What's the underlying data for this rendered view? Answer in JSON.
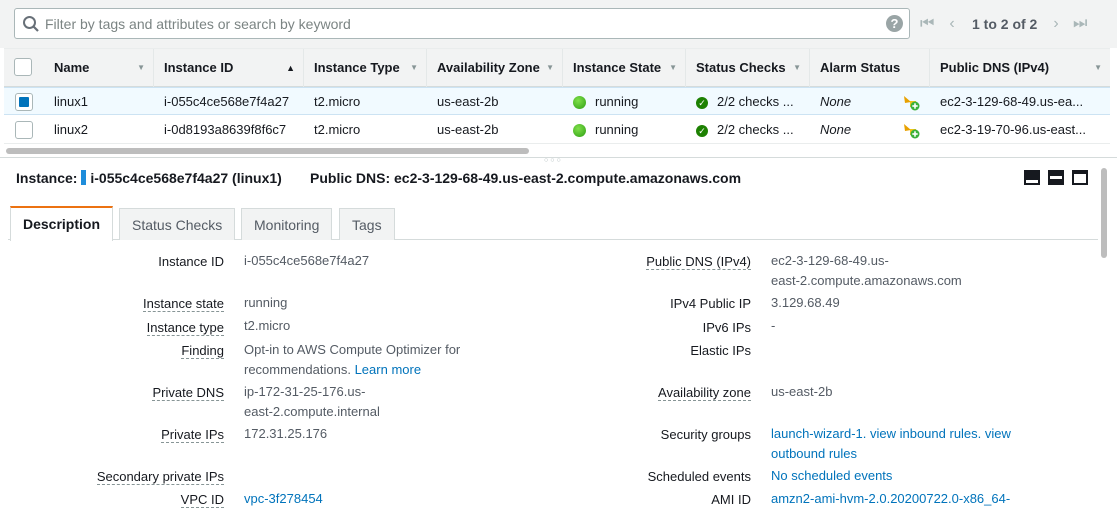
{
  "search": {
    "placeholder": "Filter by tags and attributes or search by keyword",
    "help": "?"
  },
  "pager": {
    "first": "|<",
    "prev": "<",
    "text": "1 to 2 of 2",
    "next": ">",
    "last": ">|"
  },
  "columns": [
    "Name",
    "Instance ID",
    "Instance Type",
    "Availability Zone",
    "Instance State",
    "Status Checks",
    "Alarm Status",
    "Public DNS (IPv4)"
  ],
  "rows": [
    {
      "selected": true,
      "name": "linux1",
      "id": "i-055c4ce568e7f4a27",
      "type": "t2.micro",
      "az": "us-east-2b",
      "state": "running",
      "checks": "2/2 checks ...",
      "alarm": "None",
      "dns": "ec2-3-129-68-49.us-ea..."
    },
    {
      "selected": false,
      "name": "linux2",
      "id": "i-0d8193a8639f8f6c7",
      "type": "t2.micro",
      "az": "us-east-2b",
      "state": "running",
      "checks": "2/2 checks ...",
      "alarm": "None",
      "dns": "ec2-3-19-70-96.us-east..."
    }
  ],
  "detail": {
    "instance_label": "Instance:",
    "instance_value": "i-055c4ce568e7f4a27 (linux1)",
    "dns_label": "Public DNS:",
    "dns_value": "ec2-3-129-68-49.us-east-2.compute.amazonaws.com"
  },
  "tabs": [
    "Description",
    "Status Checks",
    "Monitoring",
    "Tags"
  ],
  "left_fields": [
    {
      "label": "Instance ID",
      "value": "i-055c4ce568e7f4a27"
    },
    {
      "label": "Instance state",
      "value": "running"
    },
    {
      "label": "Instance type",
      "value": "t2.micro"
    },
    {
      "label": "Finding",
      "value1": "Opt-in to AWS Compute Optimizer for",
      "value2": "recommendations.",
      "link": "Learn more"
    },
    {
      "label": "Private DNS",
      "value1": "ip-172-31-25-176.us-",
      "value2": "east-2.compute.internal"
    },
    {
      "label": "Private IPs",
      "value": "172.31.25.176"
    },
    {
      "label": "Secondary private IPs",
      "value": ""
    },
    {
      "label": "VPC ID",
      "value": "vpc-3f278454"
    }
  ],
  "right_fields": [
    {
      "label": "Public DNS (IPv4)",
      "value1": "ec2-3-129-68-49.us-",
      "value2": "east-2.compute.amazonaws.com"
    },
    {
      "label": "IPv4 Public IP",
      "value": "3.129.68.49"
    },
    {
      "label": "IPv6 IPs",
      "value": "-"
    },
    {
      "label": "Elastic IPs",
      "value": ""
    },
    {
      "label": "Availability zone",
      "value": "us-east-2b"
    },
    {
      "label": "Security groups",
      "link1": "launch-wizard-1. view inbound rules. view",
      "link2": "outbound rules"
    },
    {
      "label": "Scheduled events",
      "link": "No scheduled events"
    },
    {
      "label": "AMI ID",
      "link": "amzn2-ami-hvm-2.0.20200722.0-x86_64-"
    }
  ],
  "colors": {
    "accent_tab": "#ec7211",
    "link": "#0073bb",
    "selected_row": "#f1faff",
    "running": "#2e9e14"
  }
}
